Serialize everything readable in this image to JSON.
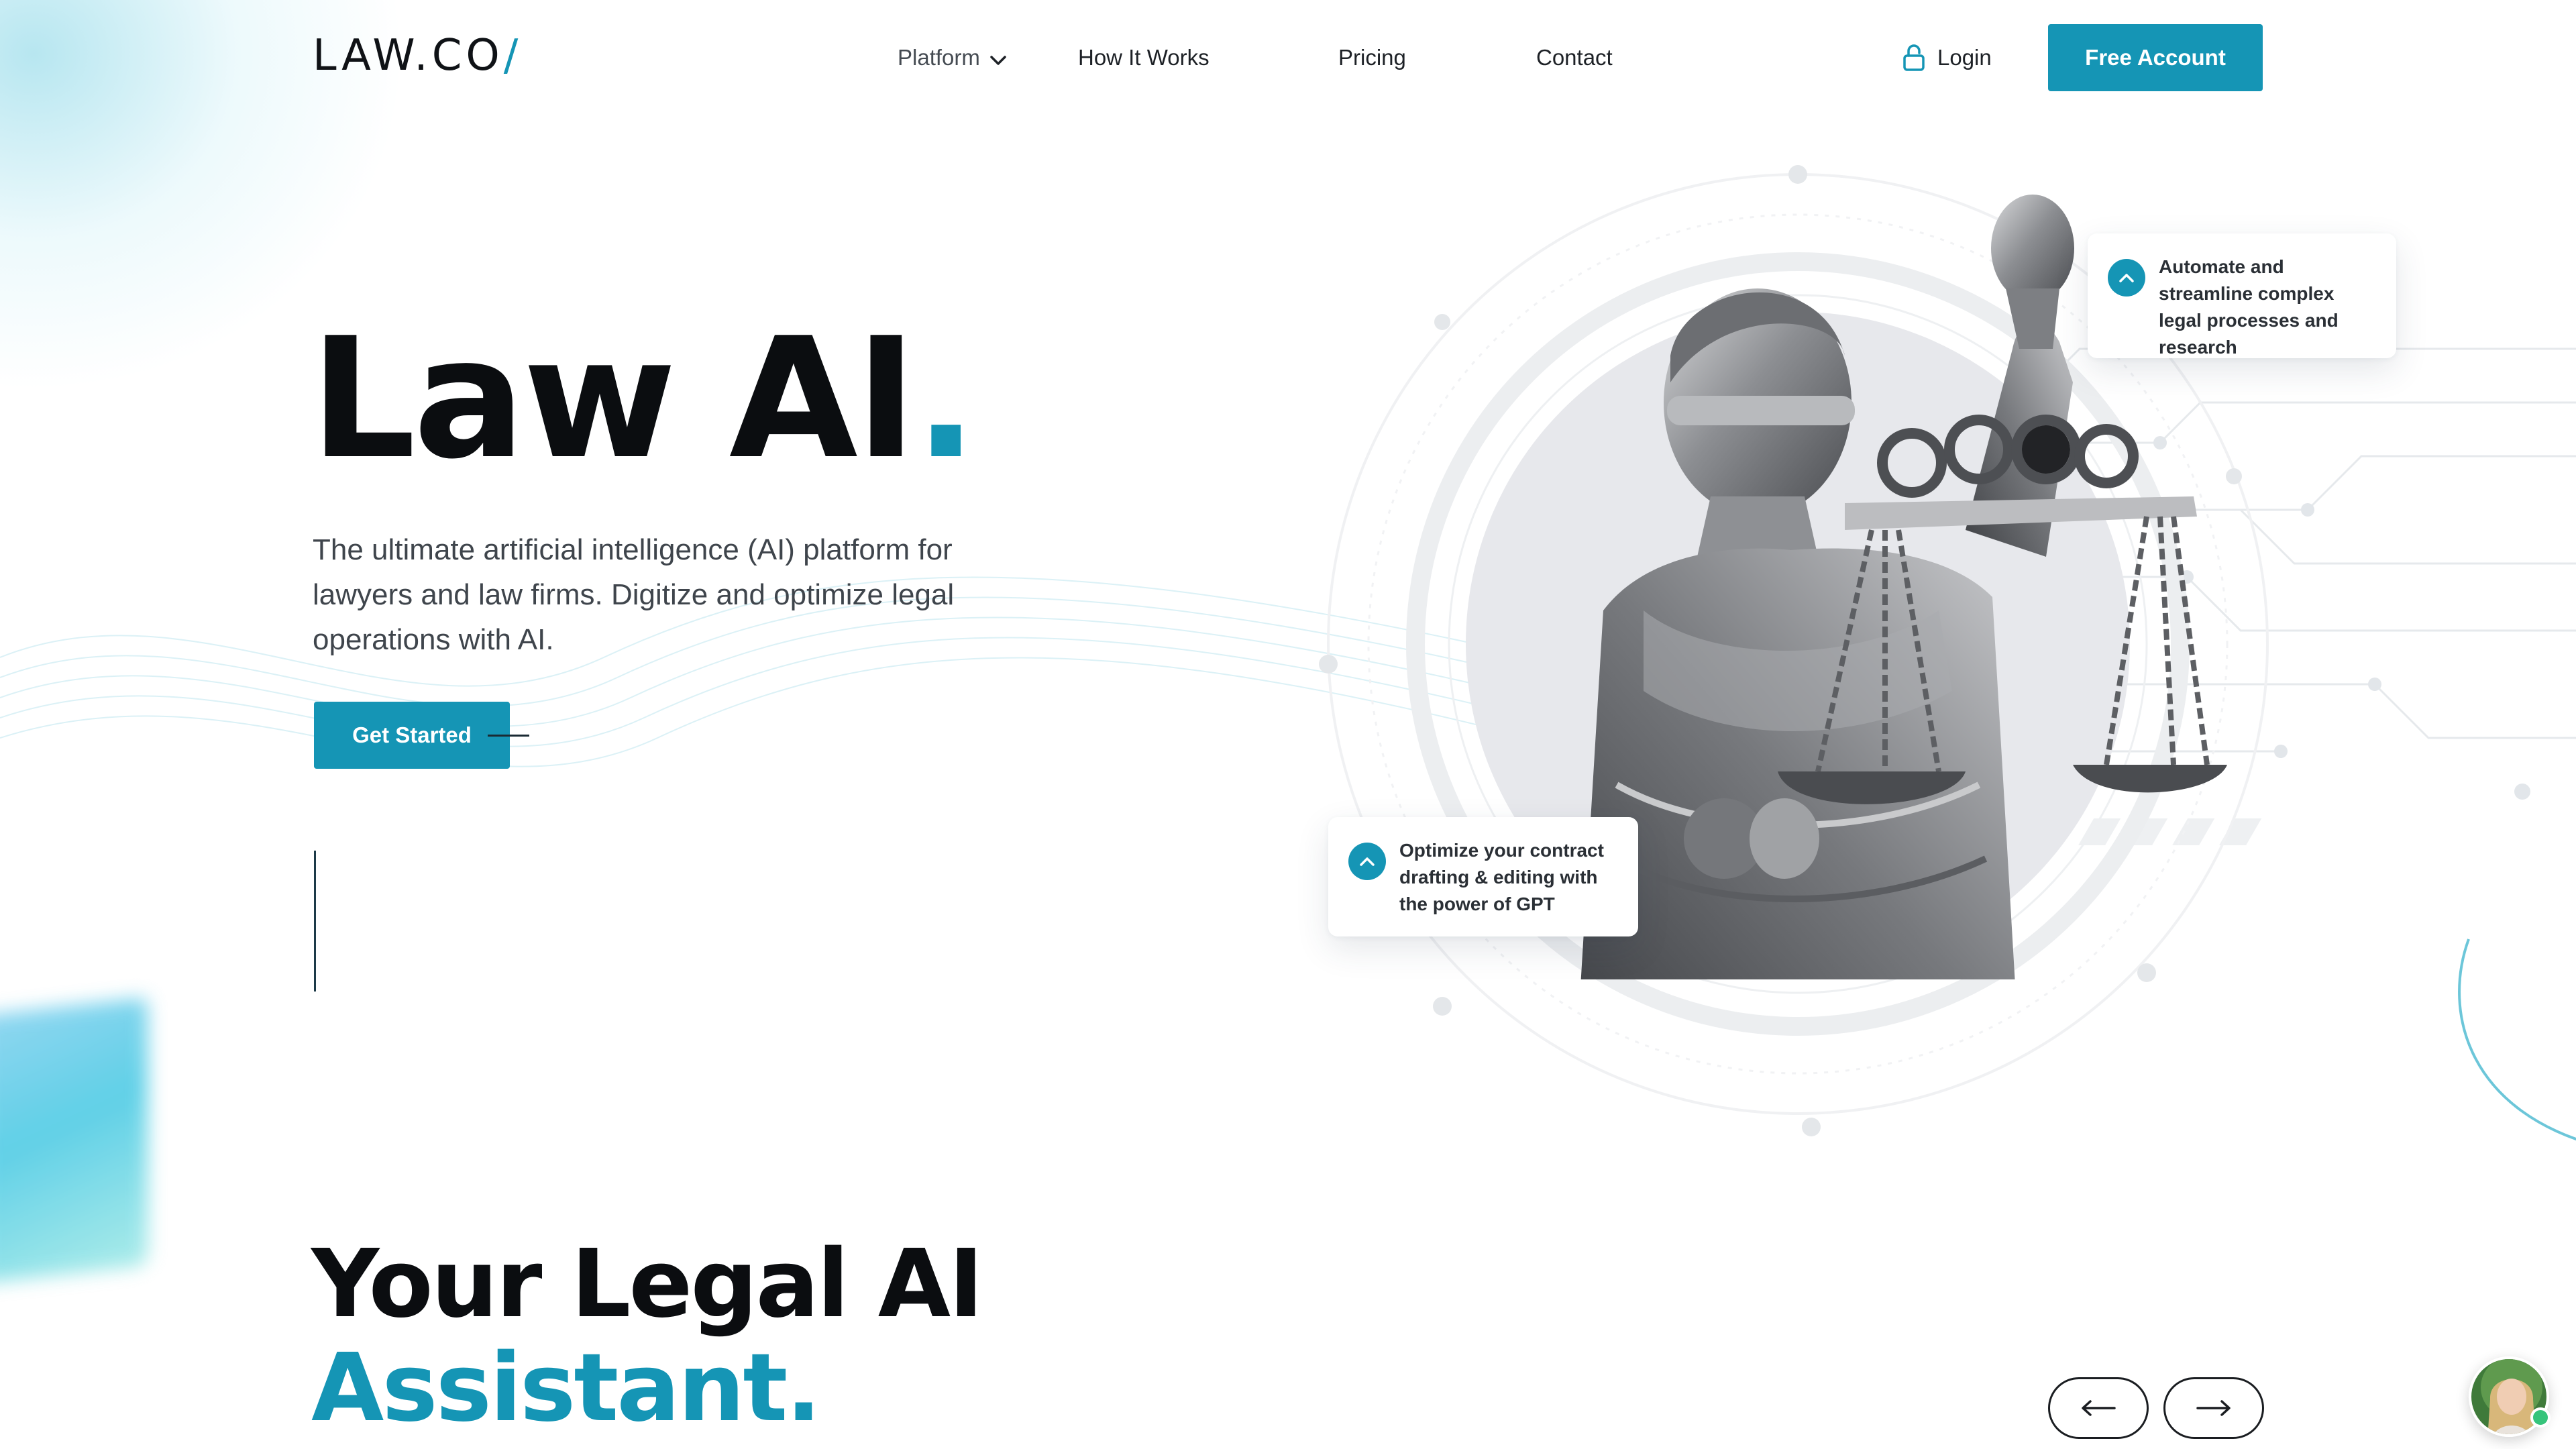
{
  "header": {
    "logo_text": "LAW.CO",
    "logo_slash": "/",
    "nav": {
      "platform": "Platform",
      "how_it_works": "How It Works",
      "pricing": "Pricing",
      "contact": "Contact"
    },
    "login": "Login",
    "free_account": "Free Account"
  },
  "hero": {
    "title": "Law AI",
    "title_dot": ".",
    "description": "The ultimate artificial intelligence (AI) platform for lawyers and law firms. Digitize and optimize legal operations with AI.",
    "cta": "Get Started"
  },
  "cards": {
    "top": "Automate and streamline complex legal processes and research",
    "bottom": "Optimize your contract drafting & editing with the power of GPT"
  },
  "section2": {
    "title_line1": "Your Legal AI",
    "title_line2": "Assistant."
  },
  "colors": {
    "accent": "#1595b5",
    "text_dark": "#0b0d10",
    "text_body": "#3f454c"
  },
  "icons": [
    "chevron-down-icon",
    "lock-icon",
    "chevron-up-icon",
    "arrow-left-icon",
    "arrow-right-icon",
    "scales-of-justice-statue",
    "chat-avatar"
  ]
}
